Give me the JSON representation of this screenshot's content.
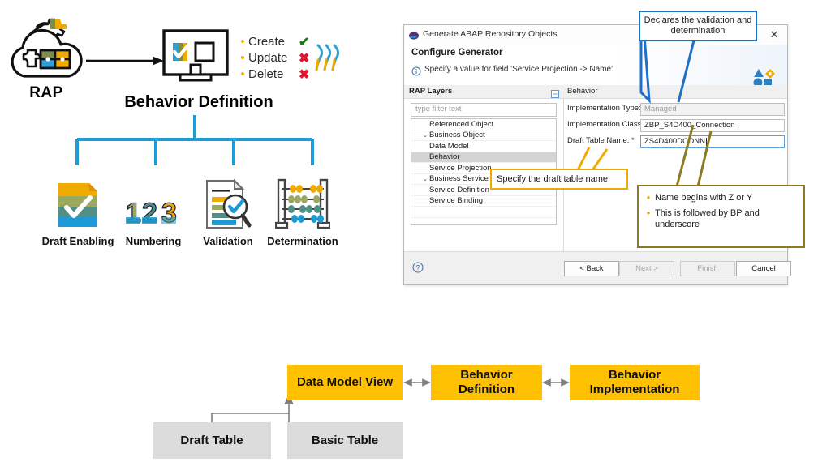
{
  "top_diagram": {
    "rap_label": "RAP",
    "cloud_icon": "rap-cloud-puzzle-gear-icon",
    "monitor_icon": "monitor-screen-icon",
    "arrow_icon": "right-arrow-icon",
    "swoosh_icon": "sap-swoosh-icon",
    "crud": [
      {
        "label": "Create",
        "mark": "✔",
        "state": "allowed"
      },
      {
        "label": "Update",
        "mark": "✖",
        "state": "not-allowed"
      },
      {
        "label": "Delete",
        "mark": "✖",
        "state": "not-allowed"
      }
    ],
    "title": "Behavior Definition",
    "leaves": [
      {
        "caption": "Draft Enabling",
        "icon": "draft-document-check-icon"
      },
      {
        "caption": "Numbering",
        "icon": "numbering-123-icon"
      },
      {
        "caption": "Validation",
        "icon": "document-magnifier-check-icon"
      },
      {
        "caption": "Determination",
        "icon": "abacus-icon"
      }
    ],
    "accent_blue": "#1f9bd8",
    "accent_orange": "#f0ab00"
  },
  "dialog": {
    "window_title": "Generate ABAP Repository Objects",
    "app_icon": "sap-logo-icon",
    "close_icon": "close-icon",
    "heading": "Configure Generator",
    "message_icon": "info-icon",
    "message": "Specify a value for field 'Service Projection -> Name'",
    "banner_icon": "wizard-shapes-icon",
    "left_pane": {
      "title": "RAP Layers",
      "collapse_icon": "collapse-all-icon",
      "filter_placeholder": "type filter text",
      "tree": [
        {
          "label": "Referenced Object",
          "indent": 0,
          "twisty": "",
          "selected": false
        },
        {
          "label": "Business Object",
          "indent": 0,
          "twisty": "⌄",
          "selected": false
        },
        {
          "label": "Data Model",
          "indent": 1,
          "twisty": "",
          "selected": false
        },
        {
          "label": "Behavior",
          "indent": 1,
          "twisty": "",
          "selected": true
        },
        {
          "label": "Service Projection",
          "indent": 0,
          "twisty": "",
          "selected": false
        },
        {
          "label": "Business Service",
          "indent": 0,
          "twisty": "⌄",
          "selected": false
        },
        {
          "label": "Service Definition",
          "indent": 1,
          "twisty": "",
          "selected": false
        },
        {
          "label": "Service Binding",
          "indent": 1,
          "twisty": "",
          "selected": false
        }
      ]
    },
    "right_pane": {
      "title": "Behavior",
      "fields": [
        {
          "label": "Implementation Type:",
          "value": "Managed",
          "state": "disabled",
          "required": false
        },
        {
          "label": "Implementation Class: *",
          "value": "ZBP_S4D400_Connection",
          "state": "normal",
          "required": true
        },
        {
          "label": "Draft Table Name: *",
          "value": "ZS4D400DCONN",
          "state": "focused",
          "required": true
        }
      ]
    },
    "footer": {
      "help_icon": "help-question-icon",
      "buttons": [
        {
          "label": "< Back",
          "enabled": true
        },
        {
          "label": "Next >",
          "enabled": false
        },
        {
          "label": "Finish",
          "enabled": false
        },
        {
          "label": "Cancel",
          "enabled": true
        }
      ]
    }
  },
  "callouts": {
    "blue": {
      "text": "Declares the validation and determination",
      "color": "#1f6fc4"
    },
    "yellow": {
      "text": "Specify the draft table name",
      "color": "#f0ab00"
    },
    "olive": {
      "color": "#8a7b23",
      "items": [
        "Name begins with Z or Y",
        "This is followed by BP and underscore"
      ]
    }
  },
  "flow_diagram": {
    "boxes": [
      {
        "label": "Data Model View",
        "style": "orange"
      },
      {
        "label": "Behavior Definition",
        "style": "orange"
      },
      {
        "label": "Behavior Implementation",
        "style": "orange"
      },
      {
        "label": "Draft Table",
        "style": "gray"
      },
      {
        "label": "Basic Table",
        "style": "gray"
      }
    ],
    "orange_hex": "#ffc000",
    "gray_hex": "#dcdcdc"
  }
}
